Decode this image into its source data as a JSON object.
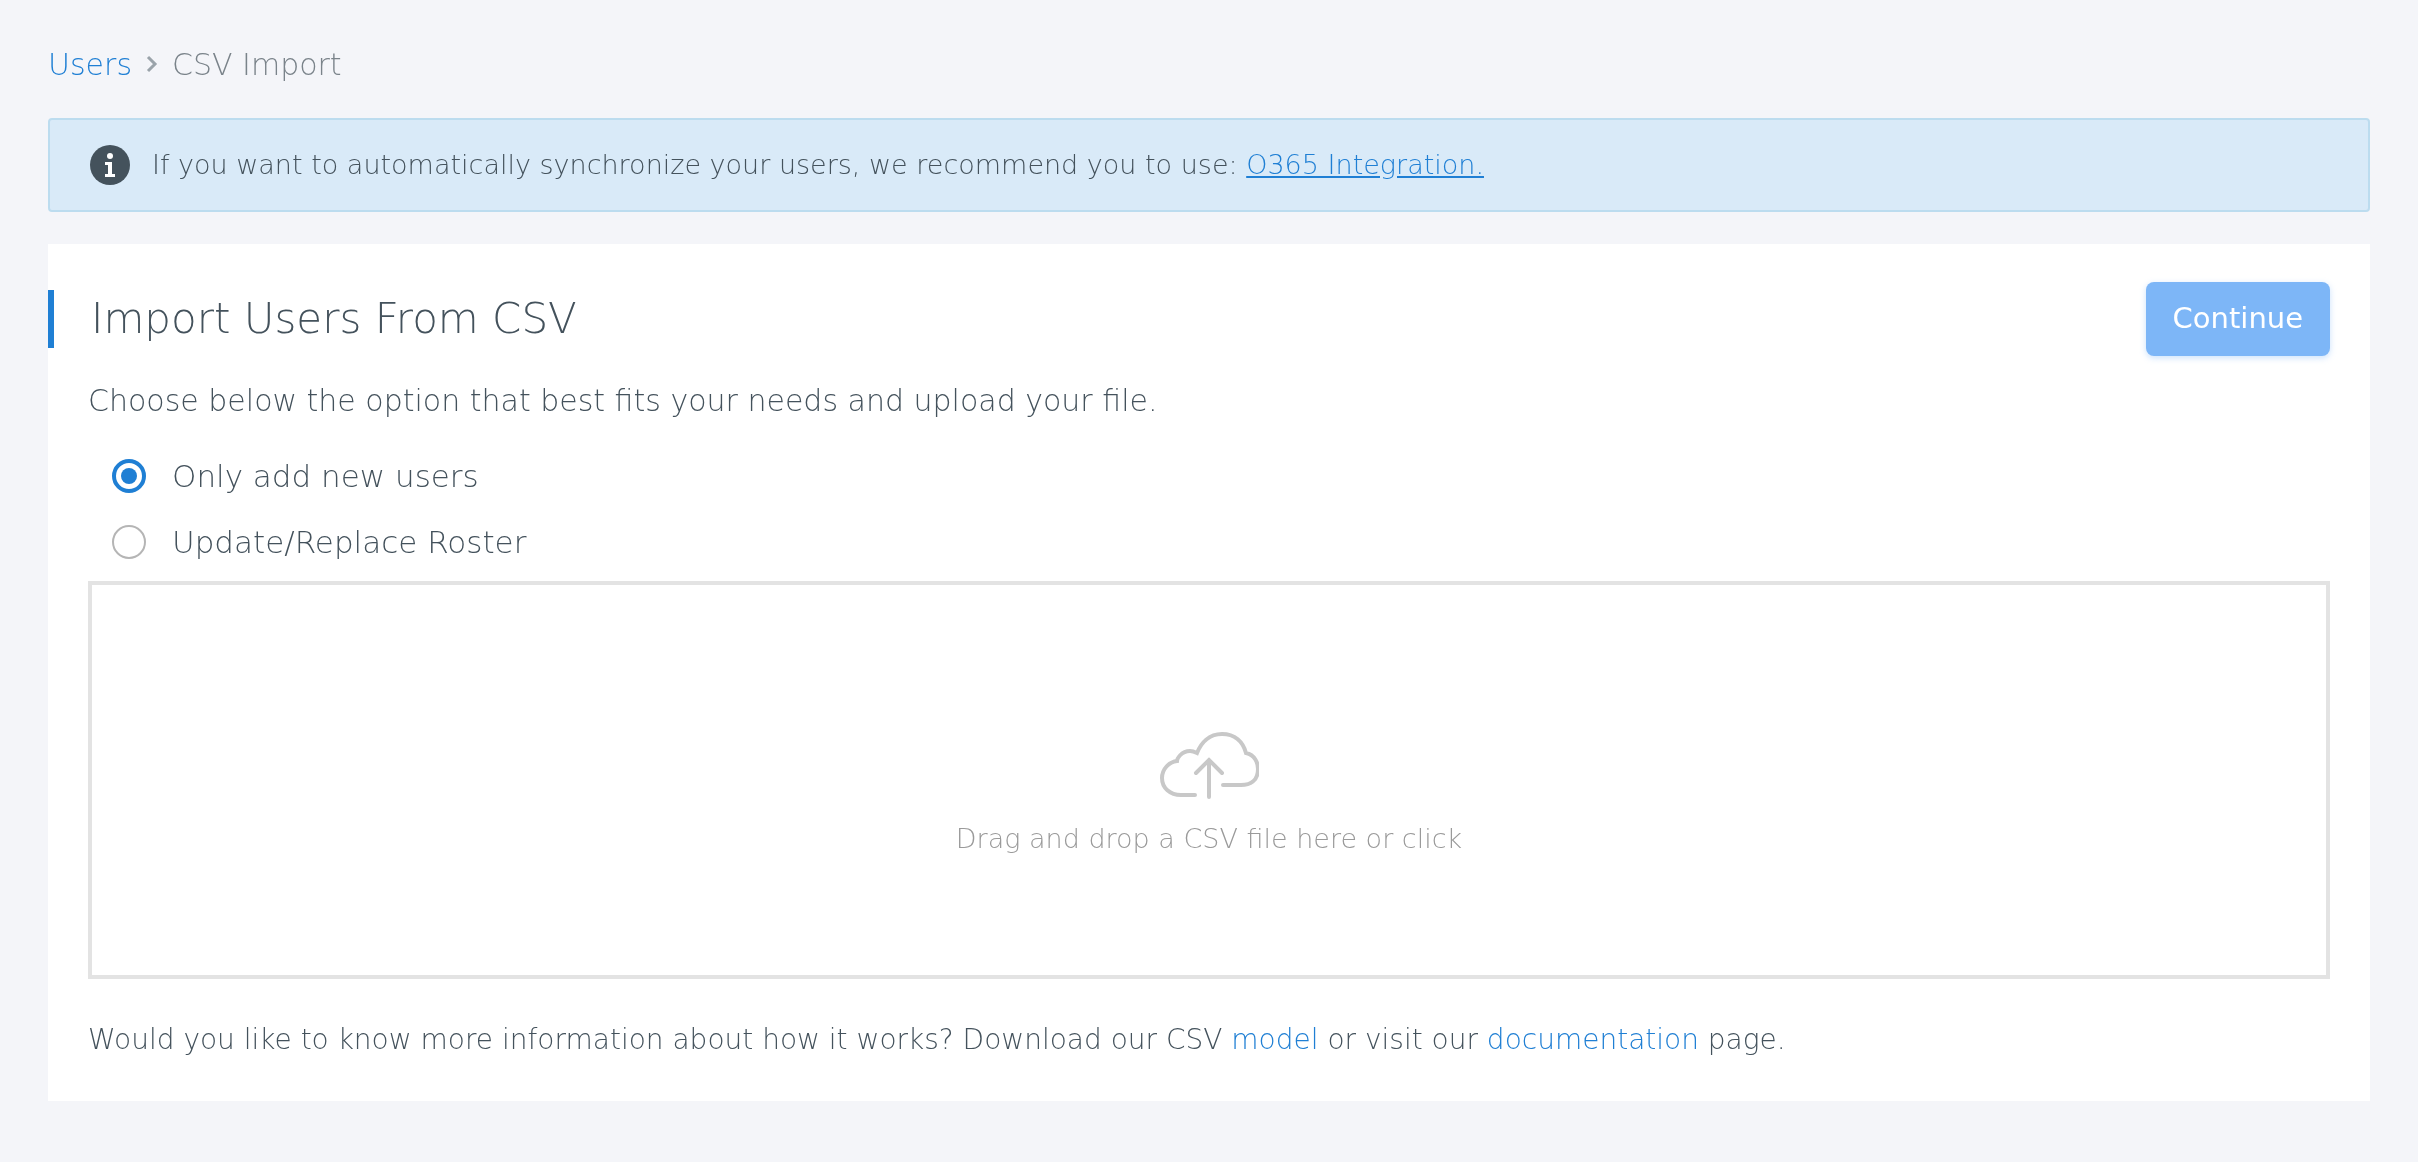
{
  "breadcrumb": [
    {
      "label": "Users",
      "kind": "link"
    },
    {
      "label": "CSV Import",
      "kind": "current"
    }
  ],
  "alert": {
    "parts": [
      {
        "kind": "text",
        "text": "If you want to automatically synchronize your users, we recommend you to use: "
      },
      {
        "kind": "link",
        "text": "O365 Integration."
      }
    ]
  },
  "panel": {
    "title": "Import Users From CSV",
    "continue_button": {
      "label": "Continue",
      "disabled": true
    },
    "description": "Choose below the option that best fits your needs and upload your file.",
    "options": [
      {
        "label": "Only add new users",
        "selected": true
      },
      {
        "label": "Update/Replace Roster",
        "selected": false
      }
    ],
    "dropzone": {
      "text": "Drag and drop a CSV file here or click"
    },
    "footer": {
      "parts": [
        {
          "kind": "text",
          "text": "Would you like to know more information about how it works? Download our CSV "
        },
        {
          "kind": "link",
          "text": "model"
        },
        {
          "kind": "text",
          "text": " or visit our "
        },
        {
          "kind": "link",
          "text": "documentation"
        },
        {
          "kind": "text",
          "text": " page."
        }
      ]
    }
  }
}
